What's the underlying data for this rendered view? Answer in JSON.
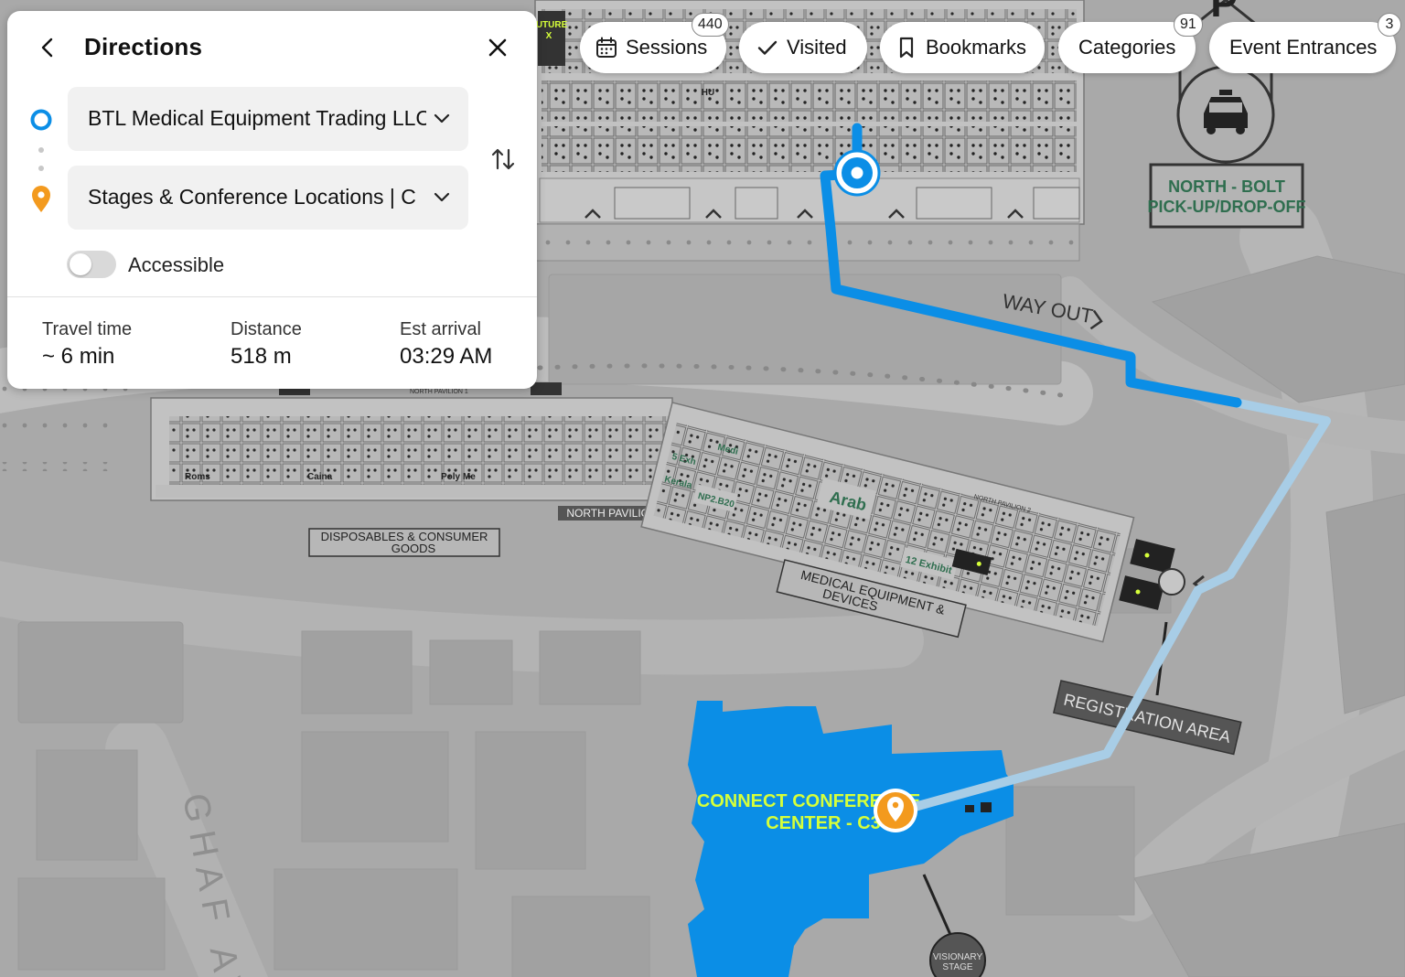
{
  "panel": {
    "title": "Directions",
    "from_value": "BTL Medical Equipment Trading LLC",
    "to_value": "Stages & Conference Locations | C",
    "accessible_label": "Accessible",
    "accessible_on": false,
    "stats": {
      "travel_time_label": "Travel time",
      "travel_time_value": "~ 6 min",
      "distance_label": "Distance",
      "distance_value": "518 m",
      "arrival_label": "Est arrival",
      "arrival_value": "03:29 AM"
    }
  },
  "chips": {
    "sessions": {
      "label": "Sessions",
      "count": "440"
    },
    "visited": {
      "label": "Visited"
    },
    "bookmarks": {
      "label": "Bookmarks"
    },
    "categories": {
      "label": "Categories",
      "count": "91"
    },
    "entrances": {
      "label": "Event Entrances",
      "count": "3"
    }
  },
  "map": {
    "labels": {
      "way_out": "WAY OUT",
      "north_bolt_1": "NORTH - BOLT",
      "north_bolt_2": "PICK-UP/DROP-OFF",
      "north_pavilion": "NORTH PAVILION",
      "disposables_1": "DISPOSABLES & CONSUMER",
      "disposables_2": "GOODS",
      "medical_1": "MEDICAL EQUIPMENT &",
      "medical_2": "DEVICES",
      "registration": "REGISTRATION AREA",
      "connect_1": "CONNECT CONFERENCE",
      "connect_2": "CENTER - C3",
      "visionary_1": "VISIONARY",
      "visionary_2": "STAGE",
      "ghaf": "GHAF AV",
      "future": "FUTURE",
      "future_x": "X",
      "arab": "Arab",
      "hall_12": "12 Exhibit",
      "np2": "NP2.B20",
      "kerala": "Kerala",
      "exh5": "5 Exh",
      "medi": "Medi",
      "roms": "Roms",
      "caina": "Caina",
      "polyme": "Poly Me",
      "north_pav_1": "NORTH PAVILION 1",
      "north_pav_2": "NORTH PAVILION 2",
      "parking": "P",
      "hu": "HU"
    },
    "colors": {
      "route_walked": "#0b8ee6",
      "route_remaining": "#a8cde6",
      "origin": "#0b8ee6",
      "destination": "#f39a1e",
      "venue_highlight": "#0b8ee6",
      "venue_label": "#d6ff3a",
      "signage_green": "#2f6e4f"
    }
  }
}
